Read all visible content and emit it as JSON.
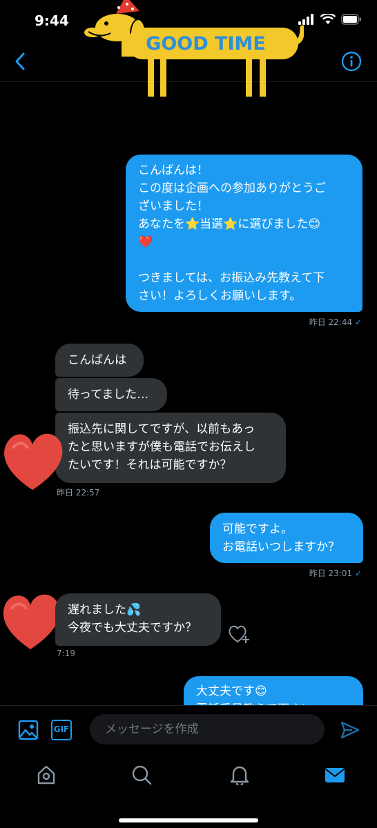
{
  "status": {
    "time": "9:44"
  },
  "header": {
    "banner_text": "GOOD TIME",
    "accent": "#1d9bf0"
  },
  "messages": [
    {
      "text": "こんばんは！\nこの度は企画への参加ありがとうご\nざいました！\nあなたを⭐当選⭐に選びました😊\n❤️\n\nつきましては、お振込み先教えて下\nさい！よろしくお願いします。"
    },
    {
      "text": "こんばんは"
    },
    {
      "text": "待ってました…"
    },
    {
      "text": "振込先に関してですが、以前もあっ\nたと思いますが僕も電話でお伝えし\nたいです！それは可能ですか？"
    },
    {
      "text": "可能ですよ。\nお電話いつしますか？"
    },
    {
      "text": "遅れました💦\n今夜でも大丈夫ですか？"
    },
    {
      "text": "大丈夫です😊\n電話番号教えて下さい"
    }
  ],
  "timestamps": {
    "t1": "昨日 22:44",
    "t2": "昨日 22:57",
    "t3": "昨日 23:01",
    "t4": "7:19"
  },
  "composer": {
    "placeholder": "メッセージを作成",
    "gif_label": "GIF"
  },
  "tabs": [
    "home-icon",
    "search-icon",
    "notifications-icon",
    "messages-icon"
  ]
}
